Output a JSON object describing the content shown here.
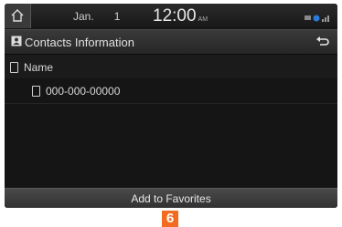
{
  "status_bar": {
    "date_month": "Jan.",
    "date_day": "1",
    "time": "12:00",
    "ampm": "AM",
    "icons": [
      "home-icon",
      "battery-icon",
      "bluetooth-icon",
      "signal-icon"
    ]
  },
  "header": {
    "title": "Contacts Information",
    "title_icon": "contact-card-icon",
    "back_icon": "back-arrow-icon"
  },
  "name_row": {
    "label": "Name",
    "icon": "person-icon"
  },
  "phone_row": {
    "number": "000-000-00000",
    "icon": "phone-icon"
  },
  "footer": {
    "button_label": "Add to Favorites"
  },
  "callout": {
    "number": "6",
    "color": "#f26b21"
  }
}
